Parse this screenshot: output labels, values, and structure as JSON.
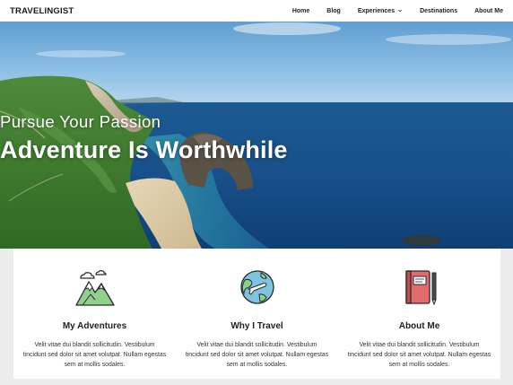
{
  "brand": {
    "name": "TRAVELINGIST"
  },
  "nav": {
    "items": [
      "Home",
      "Blog",
      "Experiences",
      "Destinations",
      "About Me"
    ]
  },
  "hero": {
    "subtitle": "Pursue Your Passion",
    "title": "Adventure Is Worthwhile"
  },
  "features": [
    {
      "icon": "mountain-icon",
      "title": "My Adventures",
      "text": "Velit vitae dui blandit sollicitudin. Vestibulum tincidunt sed dolor sit amet volutpat. Nullam egestas sem at mollis sodales."
    },
    {
      "icon": "globe-plane-icon",
      "title": "Why I Travel",
      "text": "Velit vitae dui blandit sollicitudin. Vestibulum tincidunt sed dolor sit amet volutpat. Nullam egestas sem at mollis sodales."
    },
    {
      "icon": "notebook-icon",
      "title": "About Me",
      "text": "Velit vitae dui blandit sollicitudin. Vestibulum tincidunt sed dolor sit amet volutpat. Nullam egestas sem at mollis sodales."
    }
  ]
}
